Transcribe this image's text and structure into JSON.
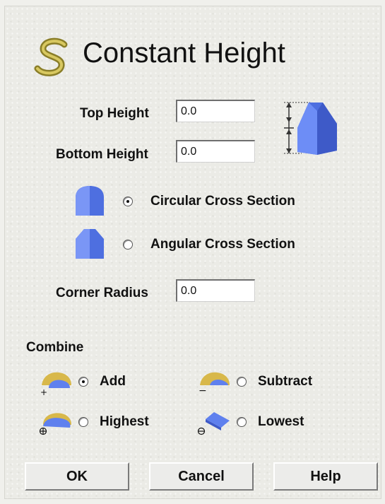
{
  "dialog": {
    "title": "Constant Height"
  },
  "heights": {
    "top_label": "Top Height",
    "top_value": "0.0",
    "bottom_label": "Bottom Height",
    "bottom_value": "0.0"
  },
  "cross_section": {
    "options": [
      {
        "label": "Circular Cross Section",
        "selected": true
      },
      {
        "label": "Angular Cross Section",
        "selected": false
      }
    ]
  },
  "corner_radius": {
    "label": "Corner Radius",
    "value": "0.0"
  },
  "combine": {
    "label": "Combine",
    "options": [
      {
        "label": "Add",
        "selected": true
      },
      {
        "label": "Subtract",
        "selected": false
      },
      {
        "label": "Highest",
        "selected": false
      },
      {
        "label": "Lowest",
        "selected": false
      }
    ]
  },
  "buttons": {
    "ok": "OK",
    "cancel": "Cancel",
    "help": "Help"
  },
  "colors": {
    "shape_blue": "#5f80ee",
    "shape_gold": "#d8b84a",
    "accent_olive": "#a89a3a"
  }
}
